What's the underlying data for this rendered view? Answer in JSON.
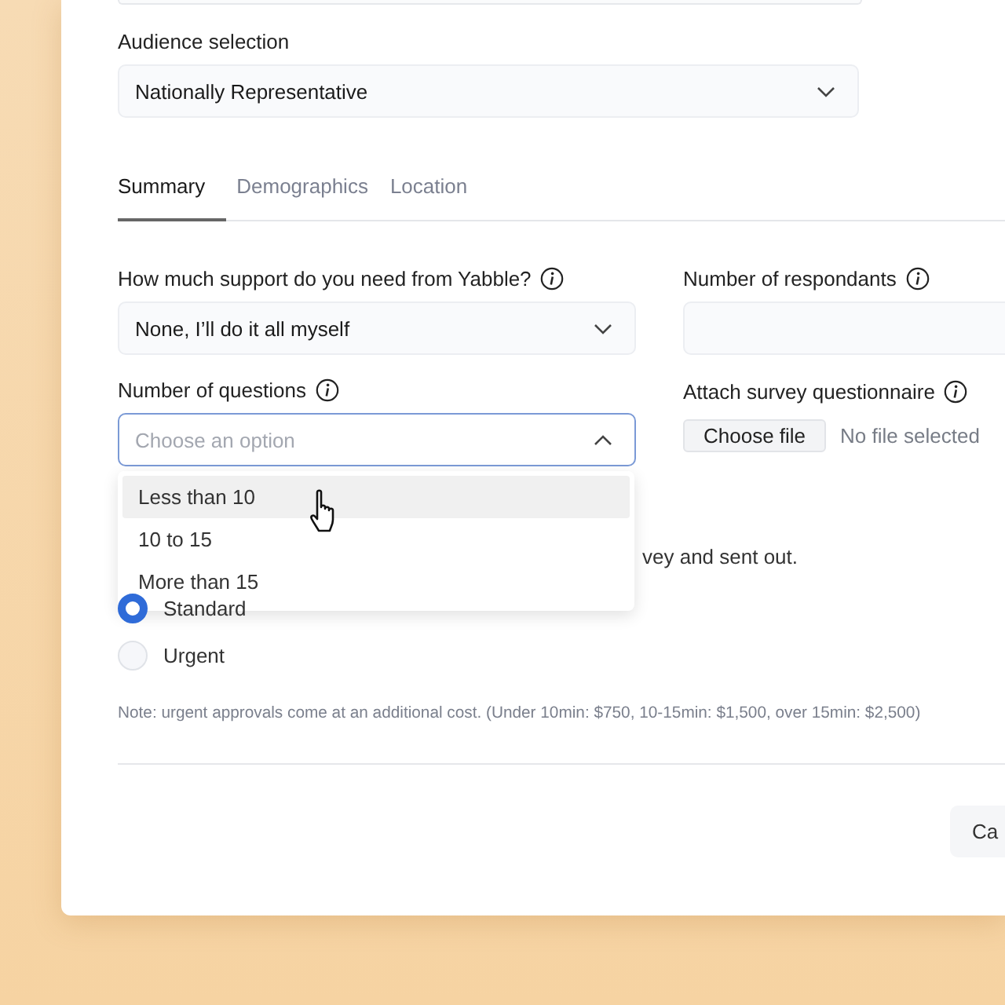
{
  "audience": {
    "label": "Audience selection",
    "value": "Nationally Representative"
  },
  "tabs": [
    {
      "label": "Summary",
      "selected": true
    },
    {
      "label": "Demographics",
      "selected": false
    },
    {
      "label": "Location",
      "selected": false
    }
  ],
  "support": {
    "label": "How much support do you need from Yabble?",
    "value": "None, I’ll do it all myself"
  },
  "respondents": {
    "label": "Number of respondants"
  },
  "questions": {
    "label": "Number of questions",
    "placeholder": "Choose an option",
    "expanded": true,
    "options": [
      {
        "label": "Less than 10",
        "highlighted": true
      },
      {
        "label": "10 to 15",
        "highlighted": false
      },
      {
        "label": "More than 15",
        "highlighted": false
      }
    ]
  },
  "attach": {
    "label": "Attach survey questionnaire",
    "button": "Choose file",
    "status": "No file selected"
  },
  "turnaround_text": "vey and sent out.",
  "priority": [
    {
      "label": "Standard",
      "selected": true
    },
    {
      "label": "Urgent",
      "selected": false
    }
  ],
  "note": "Note: urgent approvals come at an additional cost. (Under 10min: $750,  10-15min: $1,500,  over 15min: $2,500)",
  "buttons": [
    "Ca"
  ]
}
